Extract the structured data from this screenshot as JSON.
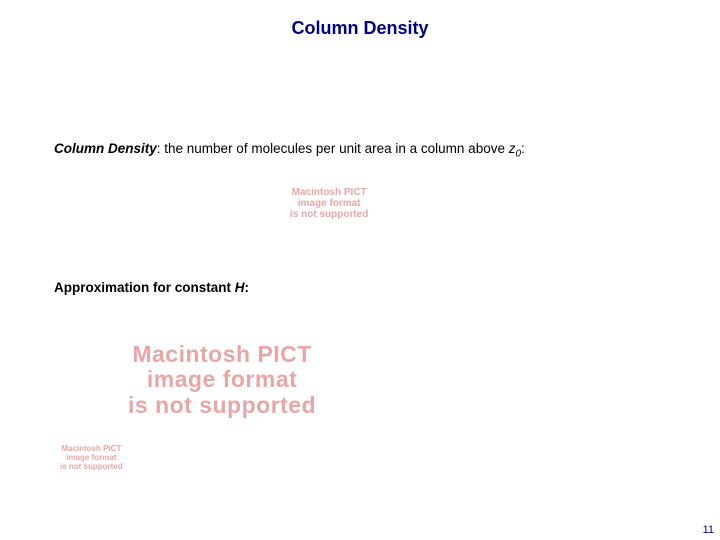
{
  "title": "Column Density",
  "definition": {
    "term": "Column Density",
    "rest1": ":  the number of molecules per unit area in a column above ",
    "var": "z",
    "sub": "0",
    "rest2": ":"
  },
  "approx": {
    "lead": "Approximation for constant ",
    "var": "H",
    "tail": ":"
  },
  "placeholder": {
    "l1": "Macintosh PICT",
    "l2": "image format",
    "l3": "is not supported"
  },
  "page_number": "11"
}
